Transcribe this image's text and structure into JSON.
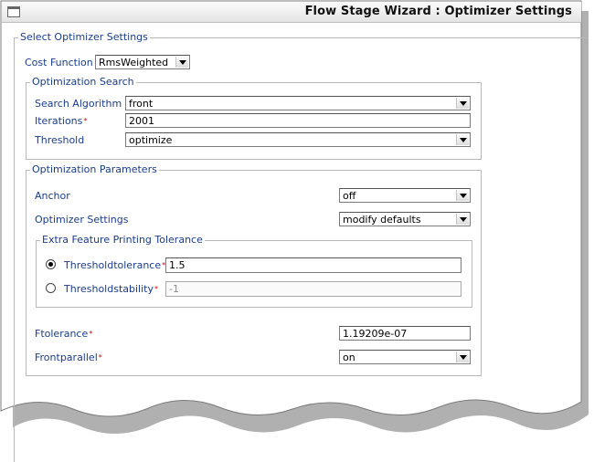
{
  "window": {
    "title": "Flow Stage Wizard : Optimizer Settings"
  },
  "optimizer_settings": {
    "legend": "Select Optimizer Settings",
    "cost_function": {
      "label": "Cost Function",
      "value": "RmsWeighted"
    }
  },
  "optimization_search": {
    "legend": "Optimization Search",
    "search_algorithm": {
      "label": "Search Algorithm",
      "value": "front"
    },
    "iterations": {
      "label": "Iterations",
      "required": "*",
      "value": "2001"
    },
    "threshold": {
      "label": "Threshold",
      "value": "optimize"
    }
  },
  "optimization_parameters": {
    "legend": "Optimization Parameters",
    "anchor": {
      "label": "Anchor",
      "value": "off"
    },
    "optimizer_settings": {
      "label": "Optimizer Settings",
      "value": "modify defaults"
    },
    "extra_tolerance": {
      "legend": "Extra Feature Printing Tolerance",
      "thresholdtolerance": {
        "label": "Thresholdtolerance",
        "required": "*",
        "value": "1.5",
        "selected": true
      },
      "thresholdstability": {
        "label": "Thresholdstability",
        "required": "*",
        "value": "-1",
        "selected": false
      }
    },
    "ftolerance": {
      "label": "Ftolerance",
      "required": "*",
      "value": "1.19209e-07"
    },
    "frontparallel": {
      "label": "Frontparallel",
      "required": "*",
      "value": "on"
    }
  },
  "colors": {
    "label": "#1a3c8c",
    "required_marker": "#d00000",
    "border": "#b8b8b8"
  }
}
